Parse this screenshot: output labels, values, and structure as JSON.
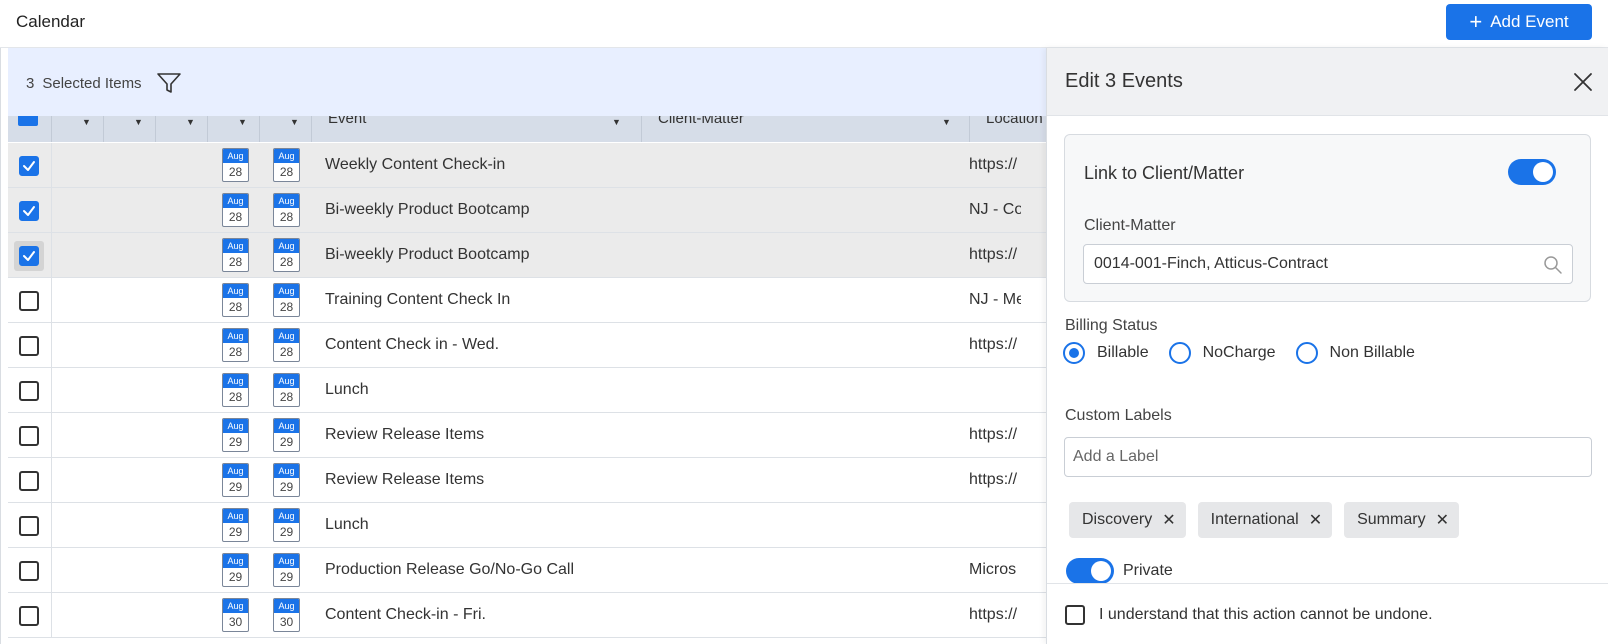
{
  "app": {
    "title": "Calendar",
    "add_button": "Add Event"
  },
  "selection": {
    "count": "3",
    "label": "Selected Items"
  },
  "table": {
    "headers": {
      "event": "Event",
      "client_matter": "Client-Matter",
      "location": "Location"
    },
    "rows": [
      {
        "selected": true,
        "focused": false,
        "start_mon": "Aug",
        "start_day": "28",
        "end_mon": "Aug",
        "end_day": "28",
        "event": "Weekly Content Check-in",
        "location": "https://"
      },
      {
        "selected": true,
        "focused": false,
        "start_mon": "Aug",
        "start_day": "28",
        "end_mon": "Aug",
        "end_day": "28",
        "event": "Bi-weekly Product Bootcamp",
        "location": "NJ - Cor"
      },
      {
        "selected": true,
        "focused": true,
        "start_mon": "Aug",
        "start_day": "28",
        "end_mon": "Aug",
        "end_day": "28",
        "event": "Bi-weekly Product Bootcamp",
        "location": "https://"
      },
      {
        "selected": false,
        "focused": false,
        "start_mon": "Aug",
        "start_day": "28",
        "end_mon": "Aug",
        "end_day": "28",
        "event": "Training Content Check In",
        "location": "NJ - Me"
      },
      {
        "selected": false,
        "focused": false,
        "start_mon": "Aug",
        "start_day": "28",
        "end_mon": "Aug",
        "end_day": "28",
        "event": "Content Check in - Wed.",
        "location": "https://"
      },
      {
        "selected": false,
        "focused": false,
        "start_mon": "Aug",
        "start_day": "28",
        "end_mon": "Aug",
        "end_day": "28",
        "event": "Lunch",
        "location": ""
      },
      {
        "selected": false,
        "focused": false,
        "start_mon": "Aug",
        "start_day": "29",
        "end_mon": "Aug",
        "end_day": "29",
        "event": "Review Release Items",
        "location": "https://"
      },
      {
        "selected": false,
        "focused": false,
        "start_mon": "Aug",
        "start_day": "29",
        "end_mon": "Aug",
        "end_day": "29",
        "event": "Review Release Items",
        "location": "https://"
      },
      {
        "selected": false,
        "focused": false,
        "start_mon": "Aug",
        "start_day": "29",
        "end_mon": "Aug",
        "end_day": "29",
        "event": "Lunch",
        "location": ""
      },
      {
        "selected": false,
        "focused": false,
        "start_mon": "Aug",
        "start_day": "29",
        "end_mon": "Aug",
        "end_day": "29",
        "event": "Production Release Go/No-Go Call",
        "location": "Micros"
      },
      {
        "selected": false,
        "focused": false,
        "start_mon": "Aug",
        "start_day": "30",
        "end_mon": "Aug",
        "end_day": "30",
        "event": "Content Check-in - Fri.",
        "location": "https://"
      }
    ]
  },
  "panel": {
    "title": "Edit 3 Events",
    "link_label": "Link to Client/Matter",
    "link_on": true,
    "client_matter_label": "Client-Matter",
    "client_matter_value": "0014-001-Finch, Atticus-Contract",
    "billing_label": "Billing Status",
    "billing_options": [
      {
        "label": "Billable",
        "selected": true
      },
      {
        "label": "NoCharge",
        "selected": false
      },
      {
        "label": "Non Billable",
        "selected": false
      }
    ],
    "custom_labels_label": "Custom Labels",
    "label_placeholder": "Add a Label",
    "chips": [
      "Discovery",
      "International",
      "Summary"
    ],
    "private_label": "Private",
    "private_on": true,
    "ack_label": "I understand that this action cannot be undone."
  },
  "colors": {
    "accent": "#1a73e8",
    "selection_bar": "#e8efff",
    "selected_row": "#ebebeb"
  }
}
